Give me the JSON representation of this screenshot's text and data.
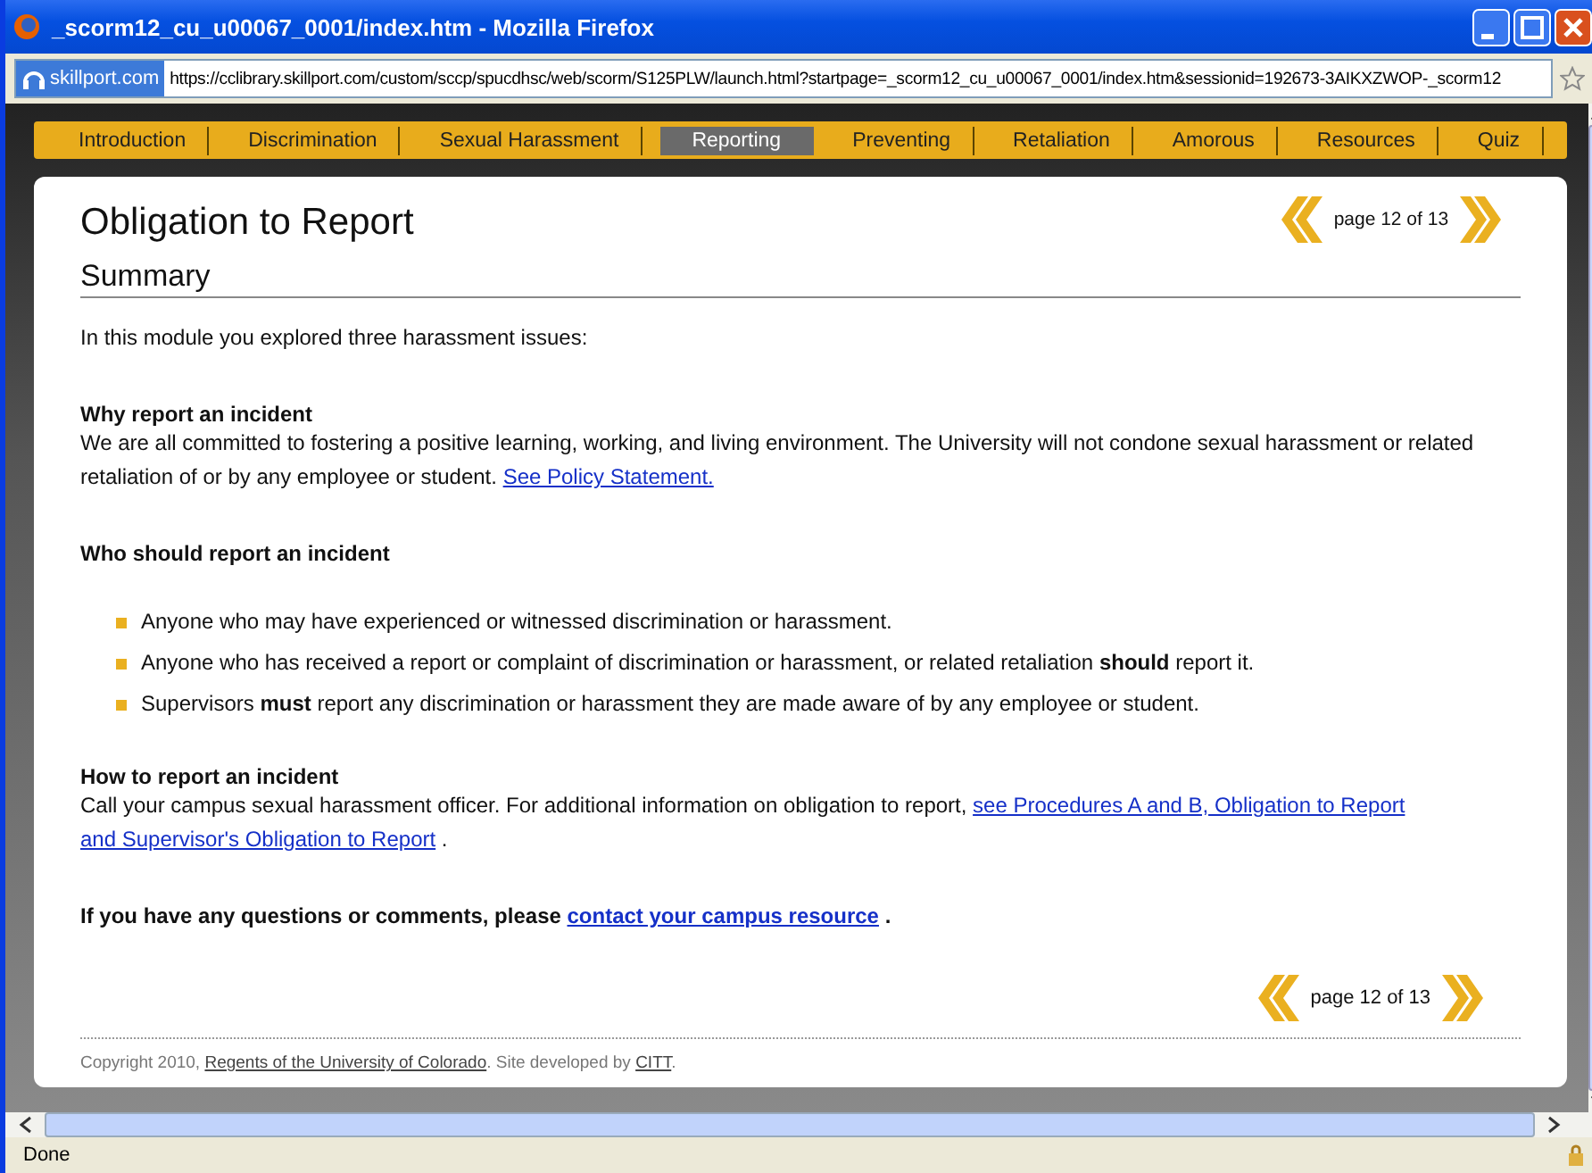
{
  "window": {
    "title": "_scorm12_cu_u00067_0001/index.htm - Mozilla Firefox"
  },
  "address_bar": {
    "site_badge": "skillport.com",
    "url": "https://cclibrary.skillport.com/custom/sccp/spucdhsc/web/scorm/S125PLW/launch.html?startpage=_scorm12_cu_u00067_0001/index.htm&sessionid=192673-3AIKXZWOP-_scorm12"
  },
  "nav": {
    "tabs": [
      {
        "label": "Introduction",
        "selected": false
      },
      {
        "label": "Discrimination",
        "selected": false
      },
      {
        "label": "Sexual Harassment",
        "selected": false
      },
      {
        "label": "Reporting",
        "selected": true
      },
      {
        "label": "Preventing",
        "selected": false
      },
      {
        "label": "Retaliation",
        "selected": false
      },
      {
        "label": "Amorous",
        "selected": false
      },
      {
        "label": "Resources",
        "selected": false
      },
      {
        "label": "Quiz",
        "selected": false
      }
    ]
  },
  "page": {
    "title": "Obligation to Report",
    "pager_top": "page 12 of 13",
    "section_heading": "Summary",
    "blocks": [
      {
        "kind": "paragraph",
        "parts": [
          {
            "kind": "text",
            "text": "In this module you explored three harassment issues:"
          }
        ]
      },
      {
        "kind": "heading",
        "text": "Why report an incident"
      },
      {
        "kind": "paragraph",
        "parts": [
          {
            "kind": "text",
            "text": "We are all committed to fostering a positive learning, working, and living environment. The University will not condone sexual harassment or related retaliation of or by any employee or student. "
          },
          {
            "kind": "link",
            "text": "See Policy Statement."
          }
        ]
      },
      {
        "kind": "heading",
        "text": "Who should report an incident"
      },
      {
        "kind": "bullets",
        "items": [
          "Anyone who may have experienced or witnessed discrimination or harassment.",
          "Anyone who has received a report or complaint of discrimination or harassment, or related retaliation **should** report it.",
          "Supervisors **must** report any discrimination or harassment they are made aware of by any employee or student."
        ]
      },
      {
        "kind": "heading",
        "text": "How to report an incident"
      },
      {
        "kind": "paragraph",
        "parts": [
          {
            "kind": "text",
            "text": "Call your campus sexual harassment officer. For additional information on obligation to report, "
          },
          {
            "kind": "link",
            "text": "see Procedures A and B, Obligation to Report"
          },
          {
            "kind": "link",
            "text": "and Supervisor's Obligation to Report"
          },
          {
            "kind": "text",
            "text": "."
          }
        ]
      },
      {
        "kind": "strong",
        "parts": [
          {
            "kind": "text",
            "text": "If you have any questions or comments, please "
          },
          {
            "kind": "link",
            "text": "contact your campus resource"
          },
          {
            "kind": "text",
            "text": "."
          }
        ]
      }
    ],
    "pager_bottom": "page 12 of 13",
    "footer": [
      {
        "kind": "text",
        "text": "Copyright 2010, "
      },
      {
        "kind": "link",
        "text": "Regents of the University of Colorado"
      },
      {
        "kind": "text",
        "text": ". Site developed by "
      },
      {
        "kind": "link",
        "text": "CITT"
      },
      {
        "kind": "text",
        "text": "."
      }
    ]
  },
  "status_bar": {
    "text": "Done"
  }
}
